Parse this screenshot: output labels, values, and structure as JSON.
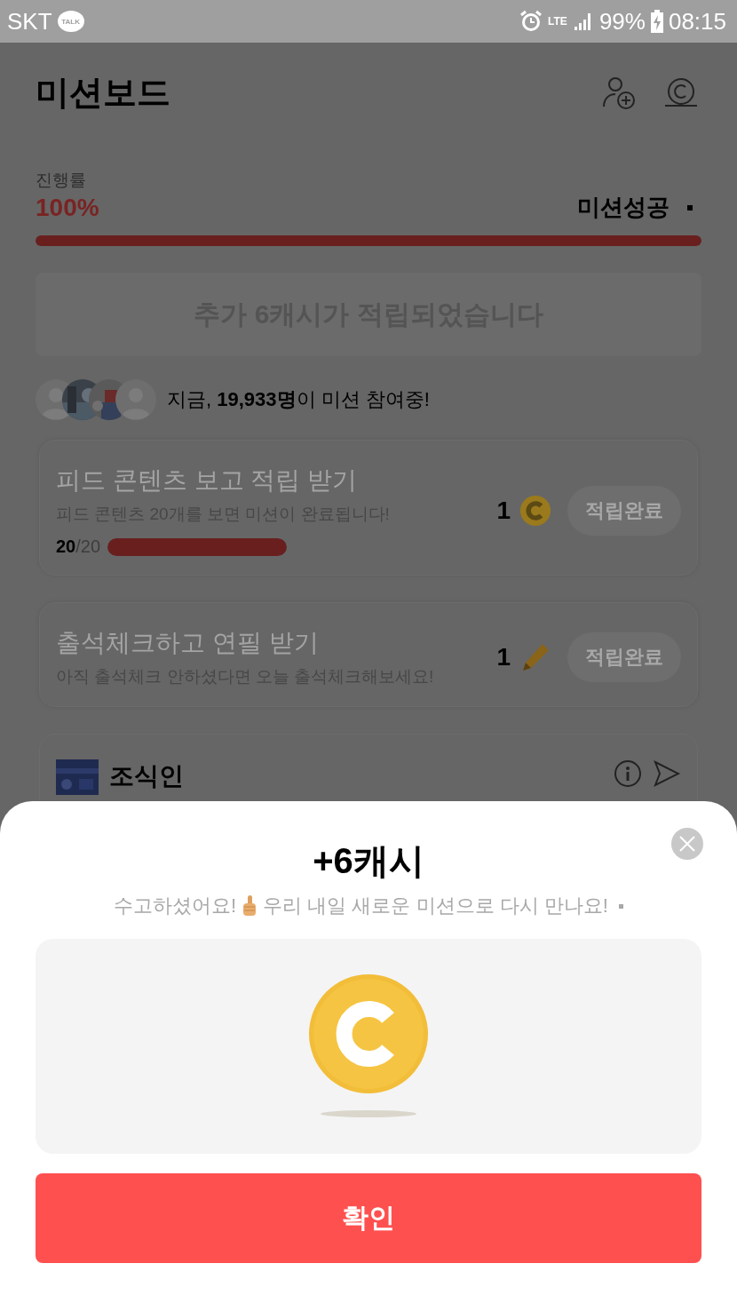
{
  "status_bar": {
    "carrier": "SKT",
    "talk_badge": "TALK",
    "network": "LTE",
    "battery": "99%",
    "time": "08:15"
  },
  "header": {
    "title": "미션보드"
  },
  "progress": {
    "label": "진행률",
    "value": "100%",
    "status": "미션성공",
    "level": 1
  },
  "banner": {
    "text": "추가 6캐시가 적립되었습니다"
  },
  "participants": {
    "text": "지금, **19,933명**이 미션 참여중!"
  },
  "missions": [
    {
      "title": "피드 콘텐츠 보고 적립 받기",
      "description": "피드 콘텐츠 20개를 보면 미션이 완료됩니다!",
      "reward": "1",
      "kind": "coin",
      "button": "적립완료",
      "progress_text": "**20**/20",
      "level": 1
    },
    {
      "title": "출석체크하고 연필 받기",
      "description": "아직 출석체크 안하셨다면 오늘 출석체크해보세요!",
      "reward": "1",
      "kind": "pencil",
      "button": "적립완료"
    }
  ],
  "partial_card": {
    "title": "조식인"
  },
  "sheet": {
    "title": "+6캐시",
    "message_start": "수고하셨어요!",
    "message_end": "우리 내일 새로운 미션으로 다시 만나요!",
    "confirm": "확인"
  }
}
